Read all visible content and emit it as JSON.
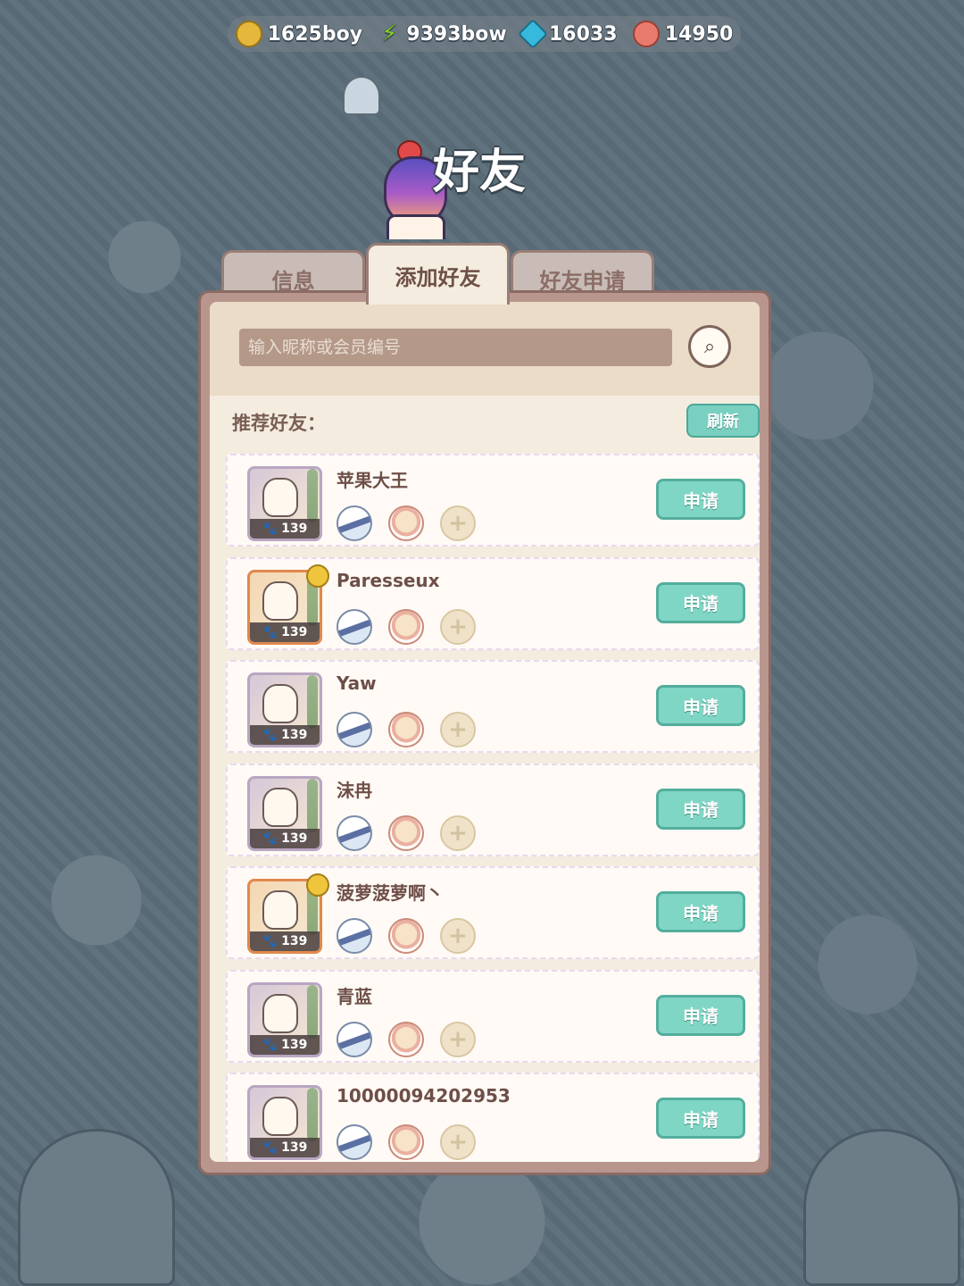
{
  "currencies": [
    {
      "icon": "coin-icon",
      "value": "1625boy"
    },
    {
      "icon": "lightning-icon",
      "value": "9393bow"
    },
    {
      "icon": "gem-icon",
      "value": "16033"
    },
    {
      "icon": "shell-icon",
      "value": "14950"
    }
  ],
  "title": "好友",
  "tabs": [
    {
      "label": "信息",
      "active": false
    },
    {
      "label": "添加好友",
      "active": true
    },
    {
      "label": "好友申请",
      "active": false
    }
  ],
  "search": {
    "placeholder": "输入昵称或会员编号"
  },
  "recommend_label": "推荐好友：",
  "refresh_label": "刷新",
  "apply_label": "申请",
  "friends": [
    {
      "name": "苹果大王",
      "level": "139",
      "frame": "silver"
    },
    {
      "name": "Paresseux",
      "level": "139",
      "frame": "gold"
    },
    {
      "name": "Yaw",
      "level": "139",
      "frame": "silver"
    },
    {
      "name": "沫冉",
      "level": "139",
      "frame": "silver"
    },
    {
      "name": "菠萝菠萝啊丶",
      "level": "139",
      "frame": "gold"
    },
    {
      "name": "青蓝",
      "level": "139",
      "frame": "silver"
    },
    {
      "name": "10000094202953",
      "level": "139",
      "frame": "silver"
    }
  ],
  "colors": {
    "accent": "#7fd6c5",
    "panel": "#f4ecdf",
    "frame": "#b8968d"
  }
}
